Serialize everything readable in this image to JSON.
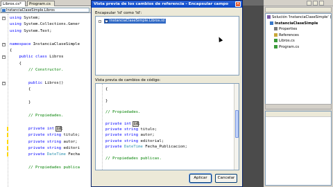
{
  "editor": {
    "tabs": [
      {
        "label": "Libros.cs*"
      },
      {
        "label": "Program.cs"
      }
    ],
    "nav_class": "InstanciaClaseSimple.Libros",
    "code_lines": [
      {
        "prefix_kw": "using",
        "text": " System;"
      },
      {
        "prefix_kw": "using",
        "text": " System.Collections.Gener"
      },
      {
        "prefix_kw": "using",
        "text": " System.Text;"
      },
      {
        "prefix_kw": "",
        "text": ""
      },
      {
        "prefix_kw": "namespace",
        "text": " InstanciaClaseSimple"
      },
      {
        "prefix_kw": "",
        "text": "{"
      },
      {
        "prefix_kw": "    public class",
        "text": " Libros"
      },
      {
        "prefix_kw": "",
        "text": "    {"
      },
      {
        "comment": "        // Constructor."
      },
      {
        "prefix_kw": "",
        "text": ""
      },
      {
        "prefix_kw": "        public",
        "text": " Libros()"
      },
      {
        "prefix_kw": "",
        "text": "        {"
      },
      {
        "prefix_kw": "",
        "text": ""
      },
      {
        "prefix_kw": "",
        "text": "        }"
      },
      {
        "prefix_kw": "",
        "text": ""
      },
      {
        "comment": "        // Propiedades."
      },
      {
        "prefix_kw": "",
        "text": ""
      },
      {
        "prefix_kw": "        private int",
        "text": " ",
        "sel": "id",
        "after": ";"
      },
      {
        "prefix_kw": "        private string",
        "text": " titulo;"
      },
      {
        "prefix_kw": "        private string",
        "text": " autor;"
      },
      {
        "prefix_kw": "        private string",
        "text": " editori"
      },
      {
        "prefix_kw": "        private",
        "type": " DateTime",
        "text": " Fecha"
      },
      {
        "prefix_kw": "",
        "text": ""
      },
      {
        "comment": "        // Propiedades publica"
      }
    ]
  },
  "dialog": {
    "title": "Vista previa de los cambios de referencia - Encapsular campo",
    "close_glyph": "×",
    "label_refs": "Encapsular 'id' como 'Id':",
    "tree_item": "InstanciaClaseSimple.Libros.id",
    "tree_check": "✓",
    "label_preview": "Vista previa de cambios de código:",
    "preview_lines": [
      {
        "text": "{"
      },
      {
        "text": ""
      },
      {
        "text": "}"
      },
      {
        "text": ""
      },
      {
        "comment": "// Propiedades."
      },
      {
        "text": ""
      },
      {
        "kw": "private int",
        "text": " ",
        "sel": "id",
        "after": ";"
      },
      {
        "kw": "private string",
        "text": " titulo;"
      },
      {
        "kw": "private string",
        "text": " autor;"
      },
      {
        "kw": "private string",
        "text": " editorial;"
      },
      {
        "kw": "private",
        "type": " DateTime",
        "text": " Fecha_Publicacion;"
      },
      {
        "text": ""
      },
      {
        "comment": "// Propiedades publicas."
      },
      {
        "text": ""
      }
    ],
    "apply_label": "Aplicar",
    "cancel_label": "Cancelar"
  },
  "solution_explorer": {
    "items": [
      {
        "label": "Solución 'InstanciaClaseSimple' (1 pr",
        "indent": 0,
        "icon_color": "#7a5aa8"
      },
      {
        "label": "InstanciaClaseSimple",
        "indent": 4,
        "icon_color": "#3a78c8",
        "bold": true
      },
      {
        "label": "Properties",
        "indent": 10,
        "icon_color": "#7a7a7a"
      },
      {
        "label": "References",
        "indent": 10,
        "icon_color": "#c8a83a"
      },
      {
        "label": "Libros.cs",
        "indent": 10,
        "icon_color": "#3a9a3a"
      },
      {
        "label": "Program.cs",
        "indent": 10,
        "icon_color": "#3a9a3a"
      }
    ]
  },
  "colors": {
    "keyword": "#0000ff",
    "comment": "#008000",
    "type": "#2b91af",
    "titlebar": "#0a48c8"
  }
}
